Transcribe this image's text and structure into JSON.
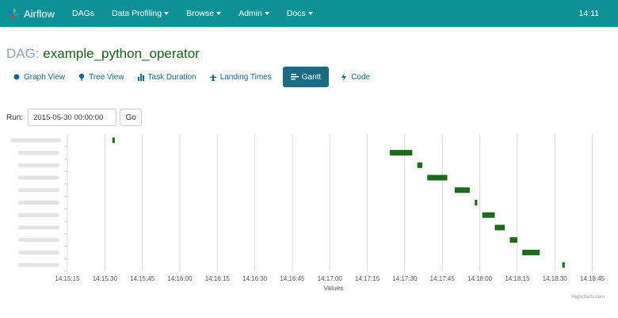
{
  "navbar": {
    "brand": "Airflow",
    "items": [
      {
        "label": "DAGs",
        "dropdown": false
      },
      {
        "label": "Data Profiling",
        "dropdown": true
      },
      {
        "label": "Browse",
        "dropdown": true
      },
      {
        "label": "Admin",
        "dropdown": true
      },
      {
        "label": "Docs",
        "dropdown": true
      }
    ],
    "clock": "14:11"
  },
  "dag": {
    "prefix": "DAG:",
    "name": "example_python_operator"
  },
  "tabs": [
    {
      "label": "Graph View",
      "icon": "graph-icon",
      "active": false
    },
    {
      "label": "Tree View",
      "icon": "tree-icon",
      "active": false
    },
    {
      "label": "Task Duration",
      "icon": "bar-chart-icon",
      "active": false
    },
    {
      "label": "Landing Times",
      "icon": "plane-icon",
      "active": false
    },
    {
      "label": "Gantt",
      "icon": "gantt-icon",
      "active": true
    },
    {
      "label": "Code",
      "icon": "bolt-icon",
      "active": false
    }
  ],
  "run": {
    "label": "Run:",
    "value": "2015-05-30 00:00:00",
    "go_label": "Go"
  },
  "chart_data": {
    "type": "gantt",
    "xlabel": "Values",
    "x_ticks": [
      "14:15:15",
      "14:15:30",
      "14:15:45",
      "14:16:00",
      "14:16:15",
      "14:16:30",
      "14:16:45",
      "14:17:00",
      "14:17:15",
      "14:17:30",
      "14:17:45",
      "14:18:00",
      "14:18:15",
      "14:18:30",
      "14:18:45"
    ],
    "xlim": [
      "14:15:15",
      "14:18:48"
    ],
    "grid": "vertical",
    "bar_color": "#1b6b1b",
    "task_labels_blurred": true,
    "tasks": [
      {
        "start": "14:15:33",
        "end": "14:15:34"
      },
      {
        "start": "14:17:24",
        "end": "14:17:33"
      },
      {
        "start": "14:17:35",
        "end": "14:17:37"
      },
      {
        "start": "14:17:39",
        "end": "14:17:47"
      },
      {
        "start": "14:17:50",
        "end": "14:17:56"
      },
      {
        "start": "14:17:58",
        "end": "14:17:59"
      },
      {
        "start": "14:18:01",
        "end": "14:18:06"
      },
      {
        "start": "14:18:06",
        "end": "14:18:10"
      },
      {
        "start": "14:18:12",
        "end": "14:18:15"
      },
      {
        "start": "14:18:17",
        "end": "14:18:24"
      },
      {
        "start": "14:18:33",
        "end": "14:18:34"
      }
    ],
    "credit": "Highcharts.com"
  }
}
